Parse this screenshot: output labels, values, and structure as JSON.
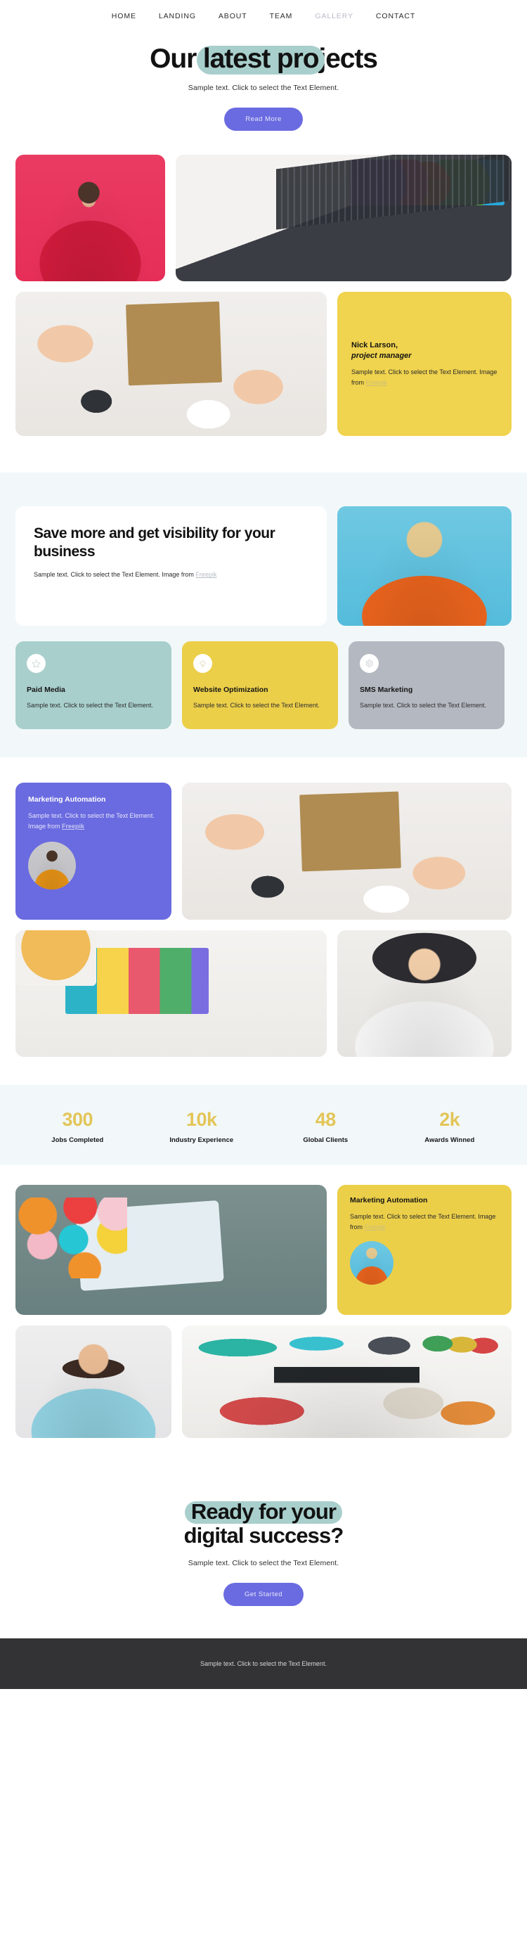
{
  "nav": {
    "items": [
      {
        "label": "HOME",
        "active": false
      },
      {
        "label": "LANDING",
        "active": false
      },
      {
        "label": "ABOUT",
        "active": false
      },
      {
        "label": "TEAM",
        "active": false
      },
      {
        "label": "GALLERY",
        "active": true
      },
      {
        "label": "CONTACT",
        "active": false
      }
    ]
  },
  "hero": {
    "title_pre": "Our ",
    "title_hl": "latest pro",
    "title_post": "jects",
    "subtitle": "Sample text. Click to select the Text Element.",
    "button": "Read More"
  },
  "testimonial": {
    "name": "Nick Larson,",
    "role": "project manager",
    "body": "Sample text. Click to select the Text Element. Image from ",
    "link": "Freepik"
  },
  "feature": {
    "heading": "Save more and get visibility for your business",
    "body": "Sample text. Click to select the Text Element. Image from ",
    "link": "Freepik"
  },
  "services": [
    {
      "icon": "star-icon",
      "title": "Paid Media",
      "body": "Sample text. Click to select the Text Element.",
      "color": "#a8cfcc"
    },
    {
      "icon": "lightbulb-icon",
      "title": "Website Optimization",
      "body": "Sample text. Click to select the Text Element.",
      "color": "#eccf49"
    },
    {
      "icon": "gear-icon",
      "title": "SMS Marketing",
      "body": "Sample text. Click to select the Text Element.",
      "color": "#b4b8c0"
    }
  ],
  "promo_purple": {
    "title": "Marketing Automation",
    "body": "Sample text. Click to select the Text Element. Image from ",
    "link": "Freepik"
  },
  "promo_yellow": {
    "title": "Marketing Automation",
    "body": "Sample text. Click to select the Text Element. Image from ",
    "link": "Freepik"
  },
  "stats": [
    {
      "number": "300",
      "label": "Jobs Completed"
    },
    {
      "number": "10k",
      "label": "Industry Experience"
    },
    {
      "number": "48",
      "label": "Global Clients"
    },
    {
      "number": "2k",
      "label": "Awards Winned"
    }
  ],
  "cta": {
    "title_hl": "Ready for your",
    "title_post": "digital success?",
    "subtitle": "Sample text. Click to select the Text Element.",
    "button": "Get Started"
  },
  "footer": {
    "text": "Sample text. Click to select the Text Element."
  },
  "colors": {
    "accent_purple": "#6a6be0",
    "accent_teal": "#a8cfcc",
    "accent_yellow": "#eccf49",
    "accent_gray": "#b4b8c0",
    "stat_number": "#e3c558",
    "section_light": "#f2f8f9",
    "footer_bg": "#333335"
  }
}
